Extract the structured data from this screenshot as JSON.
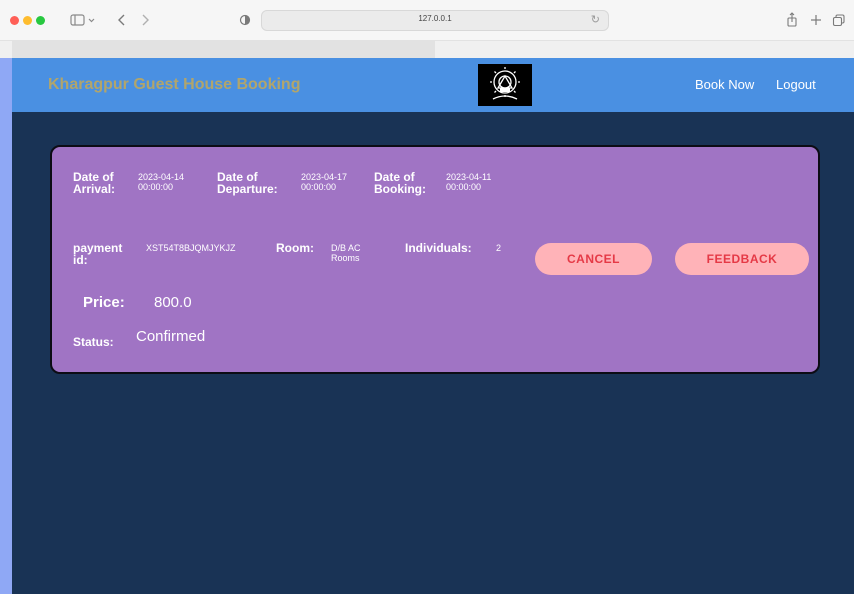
{
  "browser": {
    "url": "127.0.0.1",
    "icons": {
      "sidebar": "sidebar-icon",
      "back": "back-icon",
      "forward": "forward-icon",
      "shield": "shield-icon",
      "share": "share-icon",
      "new_tab": "plus-icon",
      "tabs": "tabs-icon"
    }
  },
  "navbar": {
    "brand": "Kharagpur Guest House Booking",
    "links": {
      "book_now": "Book Now",
      "logout": "Logout"
    },
    "colors": {
      "bar": "#4a90e2",
      "brand": "#b1a56c"
    }
  },
  "booking": {
    "arrival_label": "Date of Arrival:",
    "arrival_value": "2023-04-14 00:00:00",
    "departure_label": "Date of Departure:",
    "departure_value": "2023-04-17 00:00:00",
    "booking_label": "Date of Booking:",
    "booking_value": "2023-04-11 00:00:00",
    "payment_label": "payment id:",
    "payment_value": "XST54T8BJQMJYKJZ",
    "room_label": "Room:",
    "room_value": "D/B AC Rooms",
    "individuals_label": "Individuals:",
    "individuals_value": "2",
    "price_label": "Price:",
    "price_value": "800.0",
    "status_label": "Status:",
    "status_value": "Confirmed"
  },
  "actions": {
    "cancel": "CANCEL",
    "feedback": "FEEDBACK"
  },
  "colors": {
    "page": "#193355",
    "card": "#a074c4",
    "button": "#ffb3b8",
    "button_text": "#e53946"
  }
}
